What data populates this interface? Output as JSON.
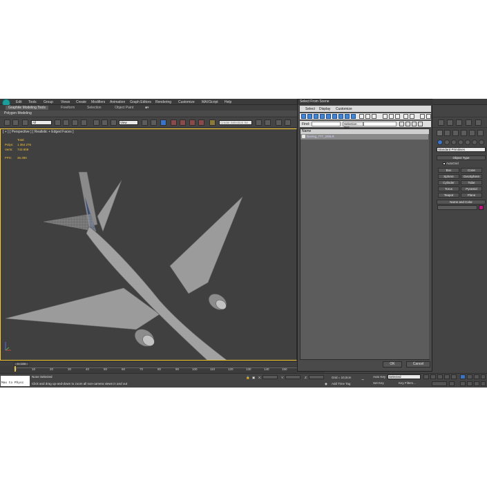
{
  "menu": {
    "items": [
      "Edit",
      "Tools",
      "Group",
      "Views",
      "Create",
      "Modifiers",
      "Animation",
      "Graph Editors",
      "Rendering",
      "Customize",
      "MAXScript",
      "Help"
    ]
  },
  "ribbon": {
    "tabs": [
      "Graphite Modeling Tools",
      "Freeform",
      "Selection",
      "Object Paint"
    ],
    "panel_label": "Polygon Modeling"
  },
  "toolbar": {
    "filter_value": "All",
    "ref_coord_value": "View",
    "named_sel_placeholder": "Create Selection Se"
  },
  "viewport": {
    "label": "[ + ] [ Perspective ] [ Realistic + Edged Faces ]",
    "stats": {
      "total_label": "Total",
      "polys_label": "Polys:",
      "polys_value": "1 364 276",
      "verts_label": "Verts:",
      "verts_value": "743 809",
      "fps_label": "FPS:",
      "fps_value": "36.390"
    },
    "object_name": "Boeing_777_200LR"
  },
  "timeline": {
    "slider_text": "0 / 220",
    "ticks": [
      "0",
      "10",
      "20",
      "30",
      "40",
      "50",
      "60",
      "70",
      "80",
      "90",
      "100",
      "110",
      "120",
      "130",
      "140",
      "150"
    ]
  },
  "status": {
    "maxscript_text": "Max to Physc",
    "selection_status": "None Selected",
    "prompt": "Click and drag up-and-down to zoom all non-camera views in and out",
    "x_label": "X:",
    "y_label": "Y:",
    "z_label": "Z:",
    "grid": "Grid = 10,0cm",
    "add_time_tag": "Add Time Tag",
    "auto_key": "Auto Key",
    "set_key": "Set Key",
    "selected_dropdown": "Selected",
    "key_filters": "Key Filters..."
  },
  "command_panel": {
    "category_dropdown": "Standard Primitives",
    "object_type_header": "Object Type",
    "autogrid_label": "AutoGrid",
    "primitives": [
      "Box",
      "Cone",
      "Sphere",
      "GeoSphere",
      "Cylinder",
      "Tube",
      "Torus",
      "Pyramid",
      "Teapot",
      "Plane"
    ],
    "name_color_header": "Name and Color",
    "swatch_color": "#c2147e"
  },
  "dialog": {
    "title": "Select From Scene",
    "menu": [
      "Select",
      "Display",
      "Customize"
    ],
    "find_label": "Find:",
    "selection_set_label": "Selection Set:",
    "column_header": "Name",
    "rows": [
      "Boeing_777_200LR"
    ],
    "ok_label": "OK",
    "cancel_label": "Cancel"
  },
  "colors": {
    "viewport_border": "#ffcc33",
    "stats_text": "#f2c338",
    "active_tool": "#4285d6",
    "logo": "#1d9d9b"
  }
}
